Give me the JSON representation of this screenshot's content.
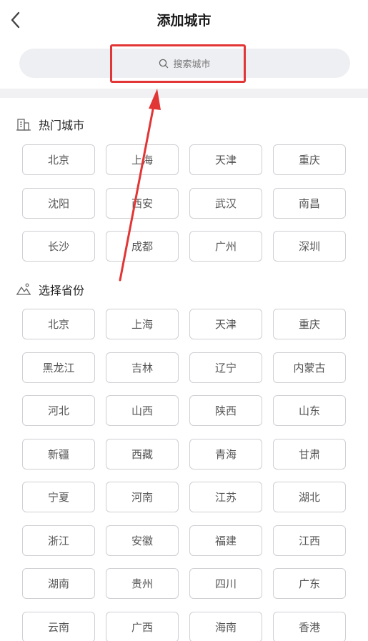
{
  "header": {
    "title": "添加城市",
    "back_icon": "chevron-left-icon"
  },
  "search": {
    "placeholder": "搜索城市",
    "icon": "search-icon"
  },
  "hot_cities": {
    "title": "热门城市",
    "icon": "building-icon",
    "items": [
      "北京",
      "上海",
      "天津",
      "重庆",
      "沈阳",
      "西安",
      "武汉",
      "南昌",
      "长沙",
      "成都",
      "广州",
      "深圳"
    ]
  },
  "provinces": {
    "title": "选择省份",
    "icon": "landscape-icon",
    "items": [
      "北京",
      "上海",
      "天津",
      "重庆",
      "黑龙江",
      "吉林",
      "辽宁",
      "内蒙古",
      "河北",
      "山西",
      "陕西",
      "山东",
      "新疆",
      "西藏",
      "青海",
      "甘肃",
      "宁夏",
      "河南",
      "江苏",
      "湖北",
      "浙江",
      "安徽",
      "福建",
      "江西",
      "湖南",
      "贵州",
      "四川",
      "广东",
      "云南",
      "广西",
      "海南",
      "香港"
    ]
  },
  "annotation": {
    "highlight_color": "#e23535"
  }
}
